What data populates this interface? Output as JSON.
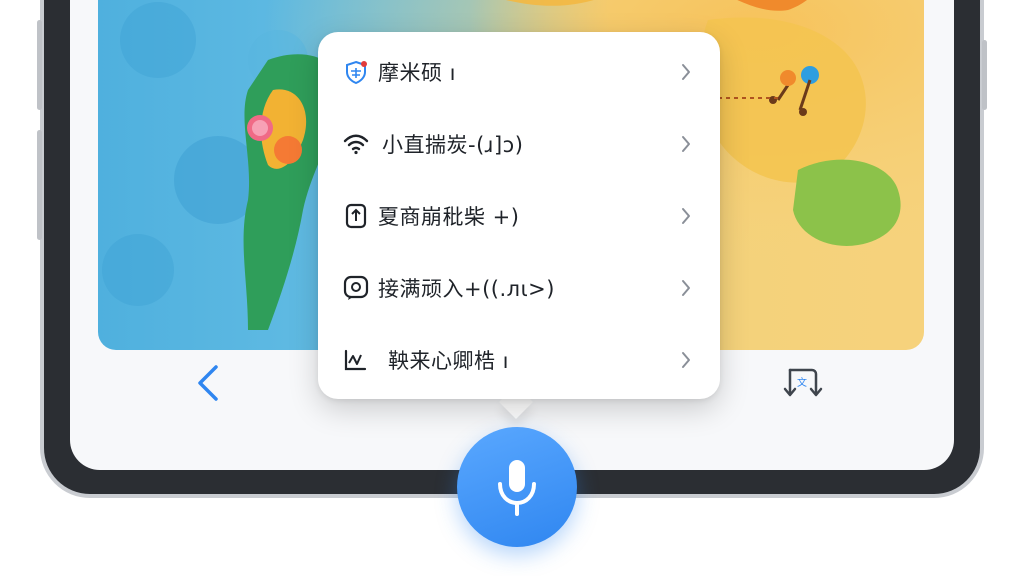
{
  "menu": {
    "items": [
      {
        "label": "摩米硕 ı",
        "icon": "shield-translate-icon"
      },
      {
        "label": "小直揣炭-(ɹ]ɔ)",
        "icon": "wifi-icon"
      },
      {
        "label": "夏商崩秕柴 +)",
        "icon": "phone-upload-icon"
      },
      {
        "label": "接满顽入+((.лι>)",
        "icon": "chat-bubble-icon"
      },
      {
        "label": "鞅来心卿梏 ı",
        "icon": "signal-chart-icon"
      }
    ]
  },
  "colors": {
    "accent": "#2f86f0",
    "menu_text": "#1f2329",
    "chevron": "#8a8f98"
  },
  "toolbar": {
    "back_icon": "chevron-left-icon",
    "translate_icon": "translate-swap-icon",
    "mic_icon": "microphone-icon"
  }
}
